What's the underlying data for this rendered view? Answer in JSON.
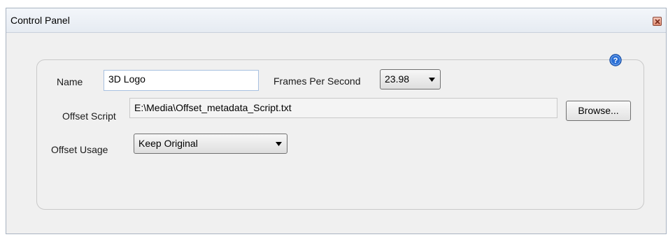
{
  "window": {
    "title": "Control Panel"
  },
  "form": {
    "name_label": "Name",
    "name_value": "3D Logo",
    "fps_label": "Frames Per Second",
    "fps_value": "23.98",
    "offset_script_label": "Offset Script",
    "offset_script_value": "E:\\Media\\Offset_metadata_Script.txt",
    "browse_label": "Browse...",
    "offset_usage_label": "Offset Usage",
    "offset_usage_value": "Keep Original"
  },
  "icons": {
    "help": "help-icon",
    "close": "close-icon",
    "dropdown": "chevron-down-icon"
  },
  "colors": {
    "help_blue": "#2a6fd6",
    "close_red": "#e08e74",
    "input_border": "#a8c1e0"
  }
}
